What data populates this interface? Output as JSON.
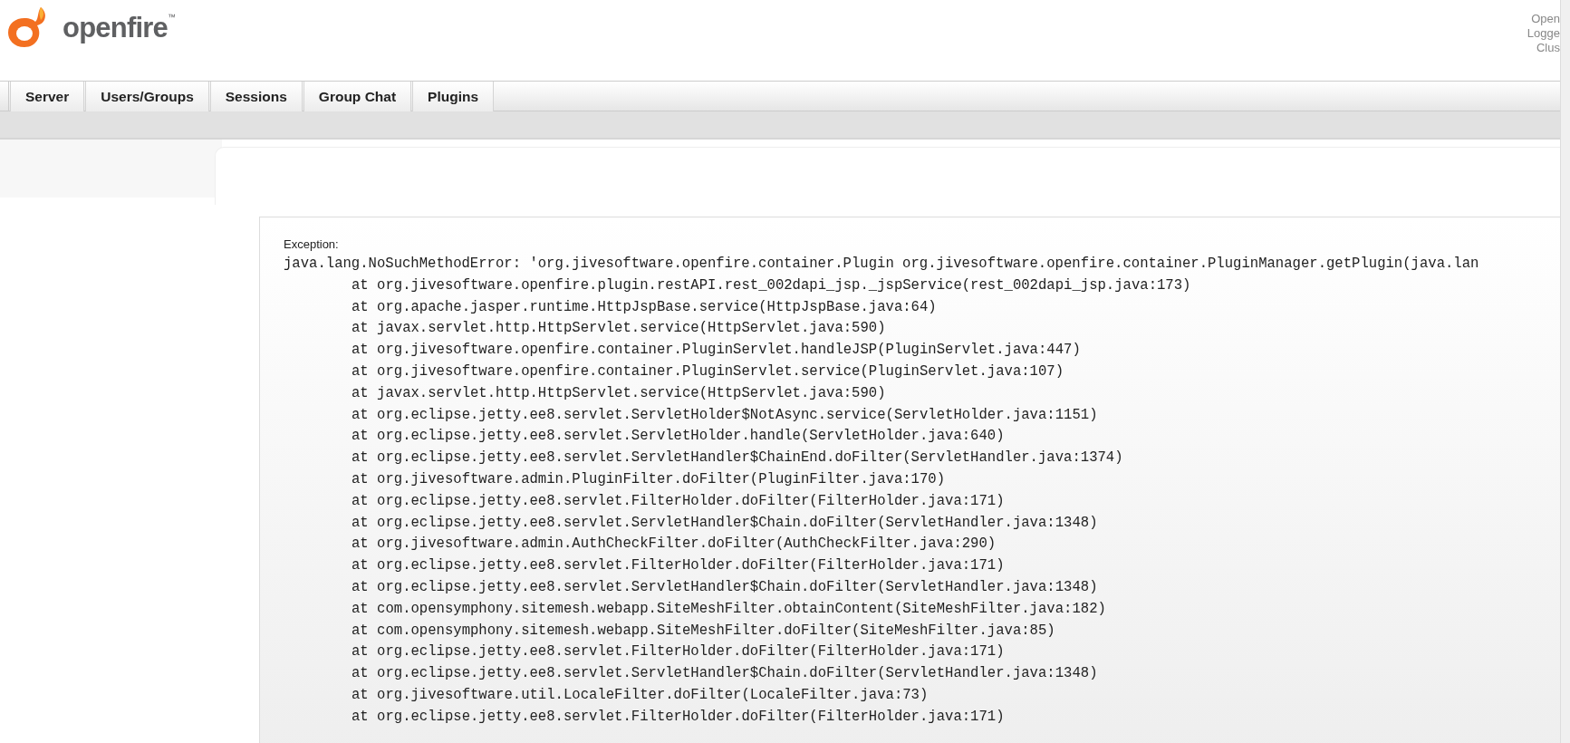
{
  "header": {
    "logo_text": "openfire",
    "trademark": "™",
    "info_lines": [
      "Open",
      "Logge",
      "Clus"
    ]
  },
  "tabs": [
    {
      "label": "Server"
    },
    {
      "label": "Users/Groups"
    },
    {
      "label": "Sessions"
    },
    {
      "label": "Group Chat"
    },
    {
      "label": "Plugins"
    }
  ],
  "exception": {
    "label": "Exception:",
    "message": "java.lang.NoSuchMethodError: 'org.jivesoftware.openfire.container.Plugin org.jivesoftware.openfire.container.PluginManager.getPlugin(java.lan",
    "stack": [
      "at org.jivesoftware.openfire.plugin.restAPI.rest_002dapi_jsp._jspService(rest_002dapi_jsp.java:173)",
      "at org.apache.jasper.runtime.HttpJspBase.service(HttpJspBase.java:64)",
      "at javax.servlet.http.HttpServlet.service(HttpServlet.java:590)",
      "at org.jivesoftware.openfire.container.PluginServlet.handleJSP(PluginServlet.java:447)",
      "at org.jivesoftware.openfire.container.PluginServlet.service(PluginServlet.java:107)",
      "at javax.servlet.http.HttpServlet.service(HttpServlet.java:590)",
      "at org.eclipse.jetty.ee8.servlet.ServletHolder$NotAsync.service(ServletHolder.java:1151)",
      "at org.eclipse.jetty.ee8.servlet.ServletHolder.handle(ServletHolder.java:640)",
      "at org.eclipse.jetty.ee8.servlet.ServletHandler$ChainEnd.doFilter(ServletHandler.java:1374)",
      "at org.jivesoftware.admin.PluginFilter.doFilter(PluginFilter.java:170)",
      "at org.eclipse.jetty.ee8.servlet.FilterHolder.doFilter(FilterHolder.java:171)",
      "at org.eclipse.jetty.ee8.servlet.ServletHandler$Chain.doFilter(ServletHandler.java:1348)",
      "at org.jivesoftware.admin.AuthCheckFilter.doFilter(AuthCheckFilter.java:290)",
      "at org.eclipse.jetty.ee8.servlet.FilterHolder.doFilter(FilterHolder.java:171)",
      "at org.eclipse.jetty.ee8.servlet.ServletHandler$Chain.doFilter(ServletHandler.java:1348)",
      "at com.opensymphony.sitemesh.webapp.SiteMeshFilter.obtainContent(SiteMeshFilter.java:182)",
      "at com.opensymphony.sitemesh.webapp.SiteMeshFilter.doFilter(SiteMeshFilter.java:85)",
      "at org.eclipse.jetty.ee8.servlet.FilterHolder.doFilter(FilterHolder.java:171)",
      "at org.eclipse.jetty.ee8.servlet.ServletHandler$Chain.doFilter(ServletHandler.java:1348)",
      "at org.jivesoftware.util.LocaleFilter.doFilter(LocaleFilter.java:73)",
      "at org.eclipse.jetty.ee8.servlet.FilterHolder.doFilter(FilterHolder.java:171)"
    ]
  }
}
